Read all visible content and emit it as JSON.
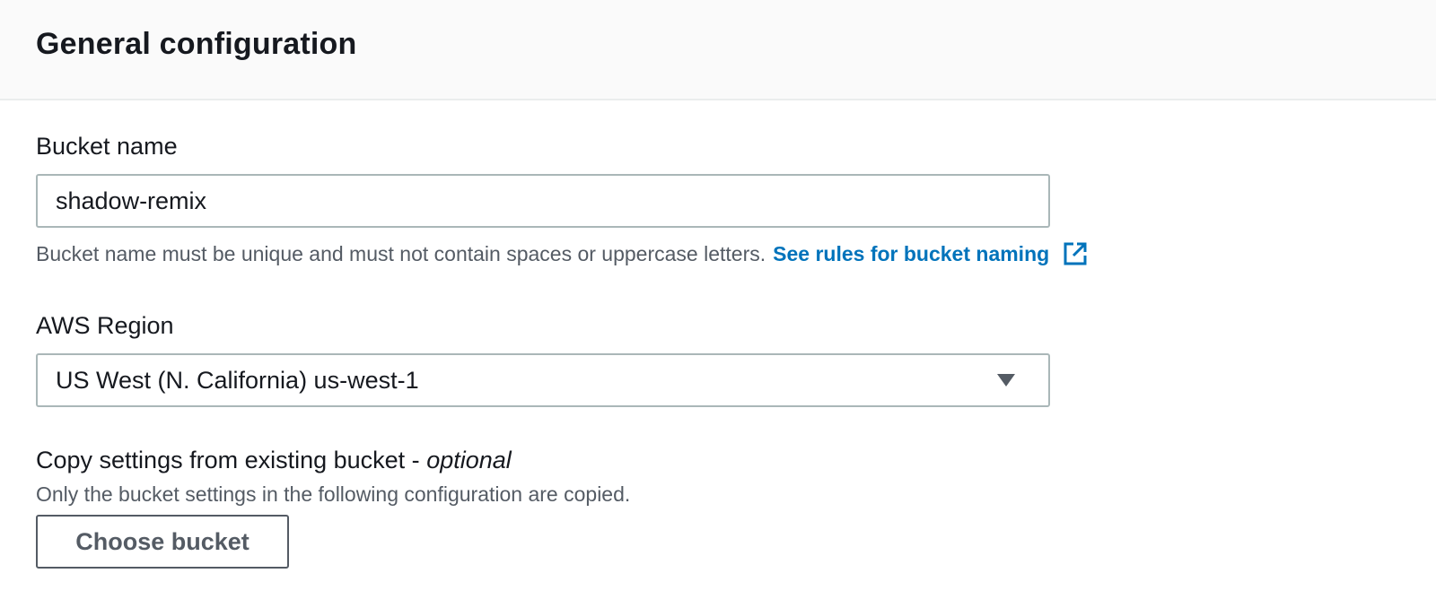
{
  "header": {
    "title": "General configuration"
  },
  "bucket_name": {
    "label": "Bucket name",
    "value": "shadow-remix",
    "hint": "Bucket name must be unique and must not contain spaces or uppercase letters.",
    "link_text": "See rules for bucket naming",
    "link_icon": "external-link-icon"
  },
  "region": {
    "label": "AWS Region",
    "selected": "US West (N. California) us-west-1",
    "icon": "caret-down-icon"
  },
  "copy_settings": {
    "label": "Copy settings from existing bucket - ",
    "label_optional": "optional",
    "description": "Only the bucket settings in the following configuration are copied.",
    "button_label": "Choose bucket"
  },
  "colors": {
    "link": "#0073bb",
    "border": "#aab7b8",
    "header_bg": "#fafafa",
    "muted_text": "#545b64"
  }
}
